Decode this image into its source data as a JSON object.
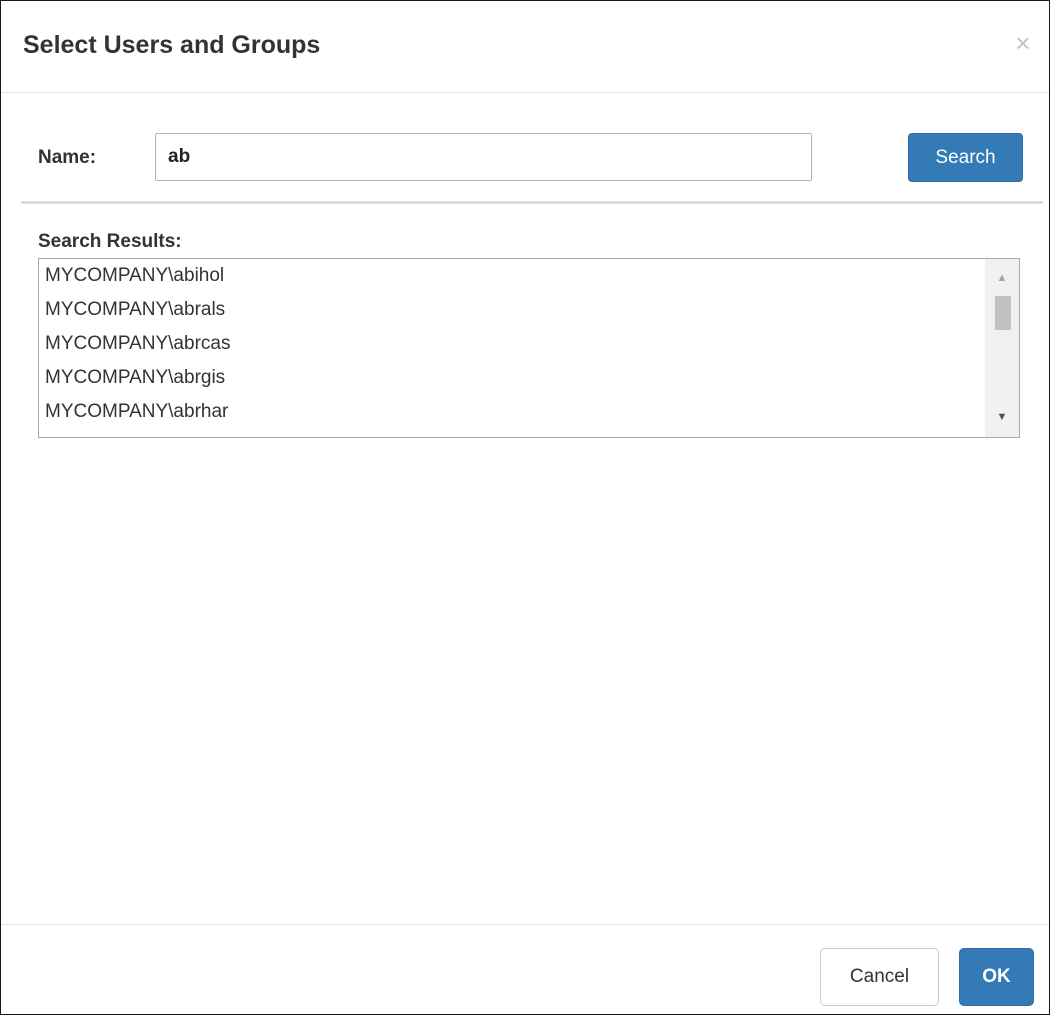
{
  "dialog": {
    "title": "Select Users and Groups",
    "close_icon": "×"
  },
  "search": {
    "name_label": "Name:",
    "name_value": "ab",
    "search_button": "Search"
  },
  "results": {
    "label": "Search Results:",
    "items": [
      "MYCOMPANY\\abihol",
      "MYCOMPANY\\abrals",
      "MYCOMPANY\\abrcas",
      "MYCOMPANY\\abrgis",
      "MYCOMPANY\\abrhar"
    ],
    "scroll_up_icon": "▲",
    "scroll_down_icon": "▼"
  },
  "footer": {
    "cancel_button": "Cancel",
    "ok_button": "OK"
  },
  "colors": {
    "primary": "#337ab7",
    "border": "#e5e5e5"
  }
}
